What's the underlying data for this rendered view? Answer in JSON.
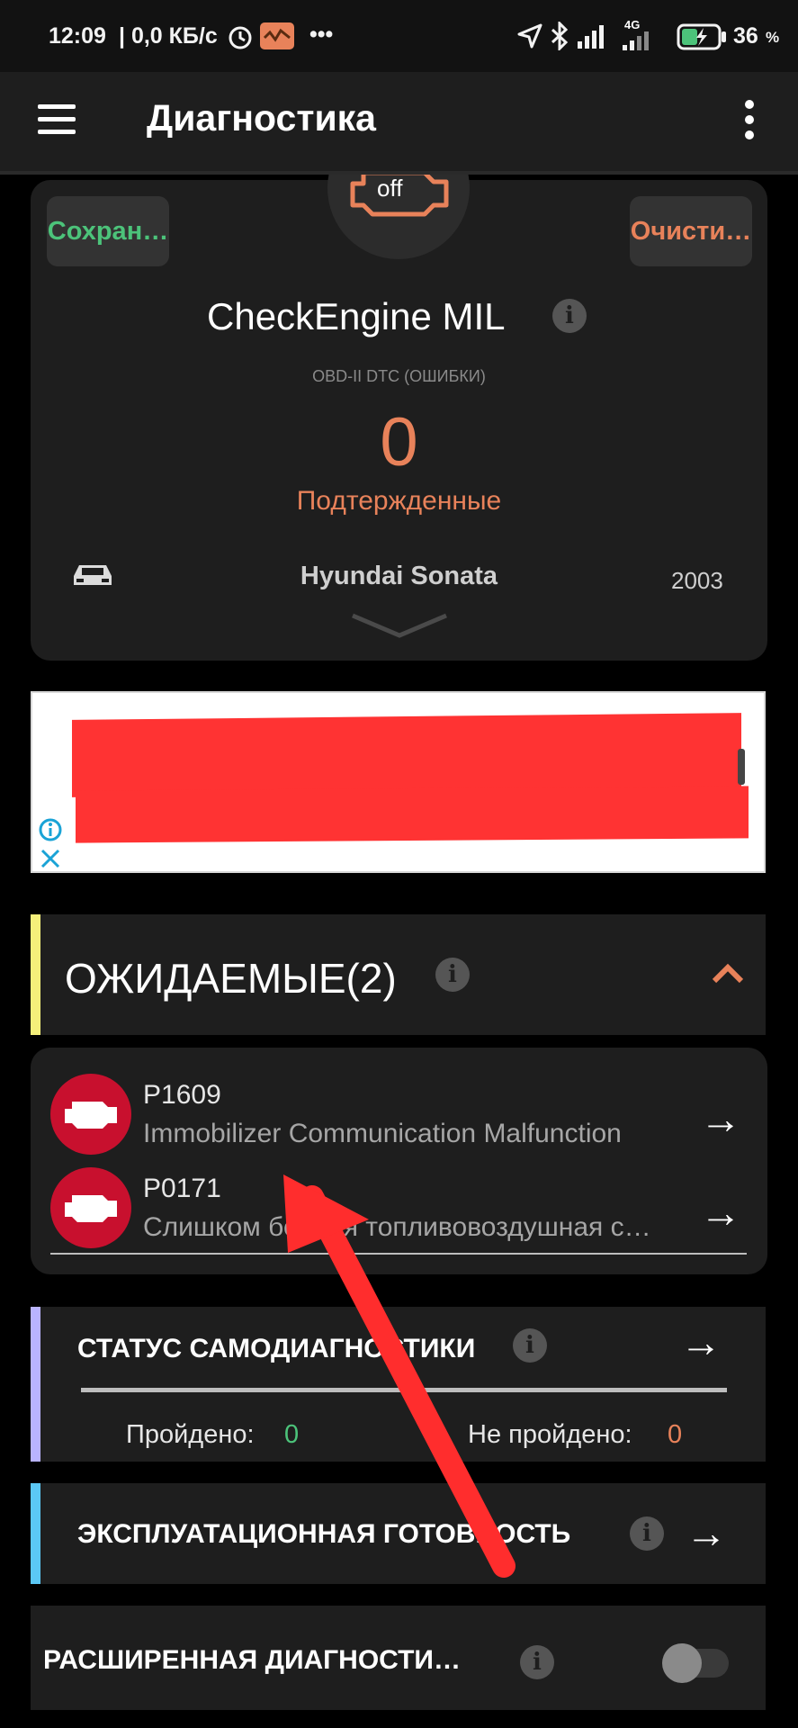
{
  "status_bar": {
    "time": "12:09",
    "speed": "| 0,0 КБ/с",
    "dots": "•••",
    "battery": "36",
    "battery_unit": "%",
    "net": "4G"
  },
  "app_bar": {
    "title": "Диагностика"
  },
  "mil_card": {
    "engine_state": "off",
    "save_label": "Сохран…",
    "clear_label": "Очисти…",
    "title": "CheckEngine MIL",
    "subtitle": "OBD-II DTC (ОШИБКИ)",
    "count": "0",
    "count_label": "Подтержденные",
    "car_name": "Hyundai Sonata",
    "car_year": "2003"
  },
  "pending": {
    "title": "ОЖИДАЕМЫЕ(2)",
    "items": [
      {
        "code": "P1609",
        "description": "Immobilizer Communication Malfunction"
      },
      {
        "code": "P0171",
        "description": "Слишком бедная топливовоздушная с…"
      }
    ]
  },
  "self_test": {
    "title": "СТАТУС САМОДИАГНОСТИКИ",
    "passed_label": "Пройдено:",
    "passed_value": "0",
    "failed_label": "Не пройдено:",
    "failed_value": "0"
  },
  "readiness": {
    "title": "ЭКСПЛУАТАЦИОННАЯ ГОТОВНОСТЬ"
  },
  "advanced": {
    "title": "РАСШИРЕННАЯ ДИАГНОСТИ…",
    "toggle_on": false
  },
  "colors": {
    "accent_orange": "#e8825a",
    "green": "#4cc37a",
    "pending_bar": "#f4ef7a",
    "selftest_bar": "#b9b3ff",
    "readiness_bar": "#5bc8f5",
    "red_icon": "#c8102e",
    "annotation_red": "#ff2d2d"
  },
  "icons": {
    "menu": "hamburger-icon",
    "overflow": "kebab-menu-icon",
    "engine": "check-engine-icon",
    "car": "car-icon",
    "info": "info-icon",
    "collapse": "chevron-up-icon",
    "expand": "chevron-down-icon",
    "open": "arrow-right-icon"
  }
}
